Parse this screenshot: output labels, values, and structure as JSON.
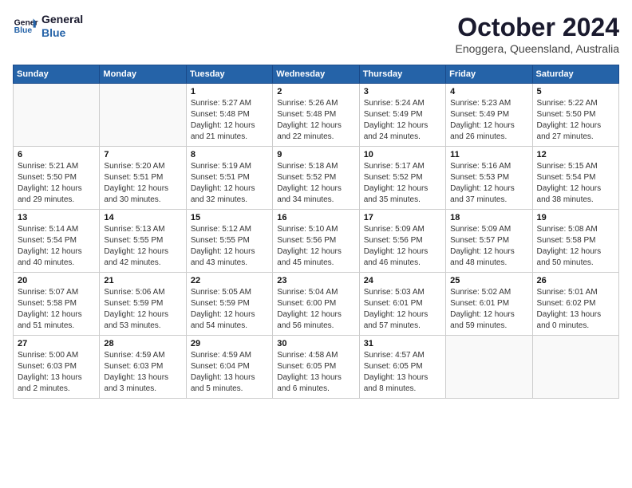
{
  "header": {
    "logo_line1": "General",
    "logo_line2": "Blue",
    "month": "October 2024",
    "location": "Enoggera, Queensland, Australia"
  },
  "weekdays": [
    "Sunday",
    "Monday",
    "Tuesday",
    "Wednesday",
    "Thursday",
    "Friday",
    "Saturday"
  ],
  "weeks": [
    [
      {
        "day": "",
        "sunrise": "",
        "sunset": "",
        "daylight": ""
      },
      {
        "day": "",
        "sunrise": "",
        "sunset": "",
        "daylight": ""
      },
      {
        "day": "1",
        "sunrise": "Sunrise: 5:27 AM",
        "sunset": "Sunset: 5:48 PM",
        "daylight": "Daylight: 12 hours and 21 minutes."
      },
      {
        "day": "2",
        "sunrise": "Sunrise: 5:26 AM",
        "sunset": "Sunset: 5:48 PM",
        "daylight": "Daylight: 12 hours and 22 minutes."
      },
      {
        "day": "3",
        "sunrise": "Sunrise: 5:24 AM",
        "sunset": "Sunset: 5:49 PM",
        "daylight": "Daylight: 12 hours and 24 minutes."
      },
      {
        "day": "4",
        "sunrise": "Sunrise: 5:23 AM",
        "sunset": "Sunset: 5:49 PM",
        "daylight": "Daylight: 12 hours and 26 minutes."
      },
      {
        "day": "5",
        "sunrise": "Sunrise: 5:22 AM",
        "sunset": "Sunset: 5:50 PM",
        "daylight": "Daylight: 12 hours and 27 minutes."
      }
    ],
    [
      {
        "day": "6",
        "sunrise": "Sunrise: 5:21 AM",
        "sunset": "Sunset: 5:50 PM",
        "daylight": "Daylight: 12 hours and 29 minutes."
      },
      {
        "day": "7",
        "sunrise": "Sunrise: 5:20 AM",
        "sunset": "Sunset: 5:51 PM",
        "daylight": "Daylight: 12 hours and 30 minutes."
      },
      {
        "day": "8",
        "sunrise": "Sunrise: 5:19 AM",
        "sunset": "Sunset: 5:51 PM",
        "daylight": "Daylight: 12 hours and 32 minutes."
      },
      {
        "day": "9",
        "sunrise": "Sunrise: 5:18 AM",
        "sunset": "Sunset: 5:52 PM",
        "daylight": "Daylight: 12 hours and 34 minutes."
      },
      {
        "day": "10",
        "sunrise": "Sunrise: 5:17 AM",
        "sunset": "Sunset: 5:52 PM",
        "daylight": "Daylight: 12 hours and 35 minutes."
      },
      {
        "day": "11",
        "sunrise": "Sunrise: 5:16 AM",
        "sunset": "Sunset: 5:53 PM",
        "daylight": "Daylight: 12 hours and 37 minutes."
      },
      {
        "day": "12",
        "sunrise": "Sunrise: 5:15 AM",
        "sunset": "Sunset: 5:54 PM",
        "daylight": "Daylight: 12 hours and 38 minutes."
      }
    ],
    [
      {
        "day": "13",
        "sunrise": "Sunrise: 5:14 AM",
        "sunset": "Sunset: 5:54 PM",
        "daylight": "Daylight: 12 hours and 40 minutes."
      },
      {
        "day": "14",
        "sunrise": "Sunrise: 5:13 AM",
        "sunset": "Sunset: 5:55 PM",
        "daylight": "Daylight: 12 hours and 42 minutes."
      },
      {
        "day": "15",
        "sunrise": "Sunrise: 5:12 AM",
        "sunset": "Sunset: 5:55 PM",
        "daylight": "Daylight: 12 hours and 43 minutes."
      },
      {
        "day": "16",
        "sunrise": "Sunrise: 5:10 AM",
        "sunset": "Sunset: 5:56 PM",
        "daylight": "Daylight: 12 hours and 45 minutes."
      },
      {
        "day": "17",
        "sunrise": "Sunrise: 5:09 AM",
        "sunset": "Sunset: 5:56 PM",
        "daylight": "Daylight: 12 hours and 46 minutes."
      },
      {
        "day": "18",
        "sunrise": "Sunrise: 5:09 AM",
        "sunset": "Sunset: 5:57 PM",
        "daylight": "Daylight: 12 hours and 48 minutes."
      },
      {
        "day": "19",
        "sunrise": "Sunrise: 5:08 AM",
        "sunset": "Sunset: 5:58 PM",
        "daylight": "Daylight: 12 hours and 50 minutes."
      }
    ],
    [
      {
        "day": "20",
        "sunrise": "Sunrise: 5:07 AM",
        "sunset": "Sunset: 5:58 PM",
        "daylight": "Daylight: 12 hours and 51 minutes."
      },
      {
        "day": "21",
        "sunrise": "Sunrise: 5:06 AM",
        "sunset": "Sunset: 5:59 PM",
        "daylight": "Daylight: 12 hours and 53 minutes."
      },
      {
        "day": "22",
        "sunrise": "Sunrise: 5:05 AM",
        "sunset": "Sunset: 5:59 PM",
        "daylight": "Daylight: 12 hours and 54 minutes."
      },
      {
        "day": "23",
        "sunrise": "Sunrise: 5:04 AM",
        "sunset": "Sunset: 6:00 PM",
        "daylight": "Daylight: 12 hours and 56 minutes."
      },
      {
        "day": "24",
        "sunrise": "Sunrise: 5:03 AM",
        "sunset": "Sunset: 6:01 PM",
        "daylight": "Daylight: 12 hours and 57 minutes."
      },
      {
        "day": "25",
        "sunrise": "Sunrise: 5:02 AM",
        "sunset": "Sunset: 6:01 PM",
        "daylight": "Daylight: 12 hours and 59 minutes."
      },
      {
        "day": "26",
        "sunrise": "Sunrise: 5:01 AM",
        "sunset": "Sunset: 6:02 PM",
        "daylight": "Daylight: 13 hours and 0 minutes."
      }
    ],
    [
      {
        "day": "27",
        "sunrise": "Sunrise: 5:00 AM",
        "sunset": "Sunset: 6:03 PM",
        "daylight": "Daylight: 13 hours and 2 minutes."
      },
      {
        "day": "28",
        "sunrise": "Sunrise: 4:59 AM",
        "sunset": "Sunset: 6:03 PM",
        "daylight": "Daylight: 13 hours and 3 minutes."
      },
      {
        "day": "29",
        "sunrise": "Sunrise: 4:59 AM",
        "sunset": "Sunset: 6:04 PM",
        "daylight": "Daylight: 13 hours and 5 minutes."
      },
      {
        "day": "30",
        "sunrise": "Sunrise: 4:58 AM",
        "sunset": "Sunset: 6:05 PM",
        "daylight": "Daylight: 13 hours and 6 minutes."
      },
      {
        "day": "31",
        "sunrise": "Sunrise: 4:57 AM",
        "sunset": "Sunset: 6:05 PM",
        "daylight": "Daylight: 13 hours and 8 minutes."
      },
      {
        "day": "",
        "sunrise": "",
        "sunset": "",
        "daylight": ""
      },
      {
        "day": "",
        "sunrise": "",
        "sunset": "",
        "daylight": ""
      }
    ]
  ]
}
